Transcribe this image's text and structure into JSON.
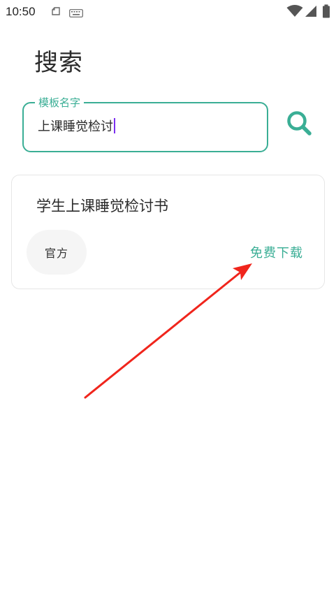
{
  "status_bar": {
    "time": "10:50",
    "left_icons": [
      "cloud-sync-icon",
      "keyboard-icon"
    ],
    "right_icons": [
      "wifi-icon",
      "cellular-signal-icon",
      "battery-icon"
    ]
  },
  "header": {
    "title": "搜索"
  },
  "search": {
    "label": "模板名字",
    "value": "上课睡觉检讨",
    "button_icon": "search-icon"
  },
  "results": [
    {
      "title": "学生上课睡觉检讨书",
      "badge": "官方",
      "action_label": "免费下载"
    }
  ],
  "annotation": {
    "type": "red-arrow",
    "points_to": "free-download-button",
    "color": "#f0251c"
  },
  "colors": {
    "accent": "#3aae95",
    "caret": "#7b2ff0",
    "badge_bg": "#f5f5f5",
    "card_border": "#e6e6e6",
    "annotation": "#f0251c"
  }
}
